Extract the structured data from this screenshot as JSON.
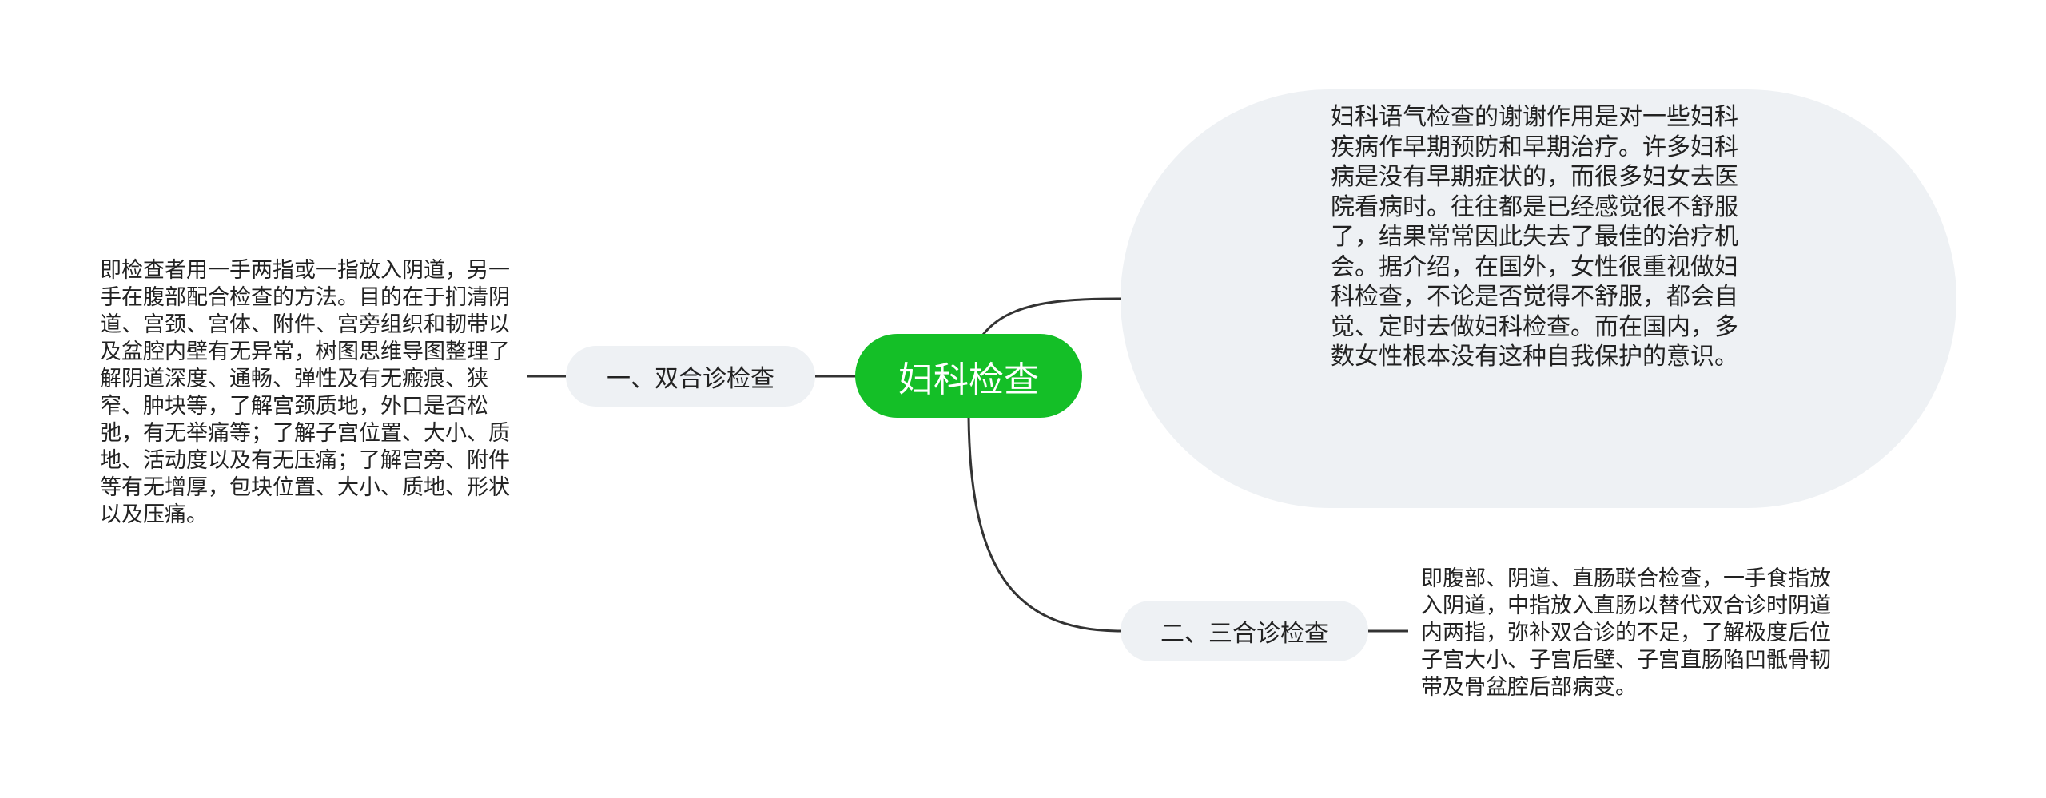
{
  "mindmap": {
    "root": {
      "label": "妇科检查",
      "color": "#14bf27"
    },
    "overview_bubble": {
      "text": "妇科语气检查的谢谢作用是对一些妇科疾病作早期预防和早期治疗。许多妇科病是没有早期症状的，而很多妇女去医院看病时。往往都是已经感觉很不舒服了，结果常常因此失去了最佳的治疗机会。据介绍，在国外，女性很重视做妇科检查，不论是否觉得不舒服，都会自觉、定时去做妇科检查。而在国内，多数女性根本没有这种自我保护的意识。"
    },
    "branches": [
      {
        "label": "一、双合诊检查",
        "detail": "即检查者用一手两指或一指放入阴道，另一手在腹部配合检查的方法。目的在于扪清阴道、宫颈、宫体、附件、宫旁组织和韧带以及盆腔内壁有无异常，树图思维导图整理了解阴道深度、通畅、弹性及有无瘢痕、狭窄、肿块等，了解宫颈质地，外口是否松弛，有无举痛等；了解子宫位置、大小、质地、活动度以及有无压痛；了解宫旁、附件等有无增厚，包块位置、大小、质地、形状以及压痛。"
      },
      {
        "label": "二、三合诊检查",
        "detail": "即腹部、阴道、直肠联合检查，一手食指放入阴道，中指放入直肠以替代双合诊时阴道内两指，弥补双合诊的不足，了解极度后位子宫大小、子宫后壁、子宫直肠陷凹骶骨韧带及骨盆腔后部病变。"
      }
    ],
    "node_fill": "#eef1f4",
    "line_color": "#333333"
  }
}
